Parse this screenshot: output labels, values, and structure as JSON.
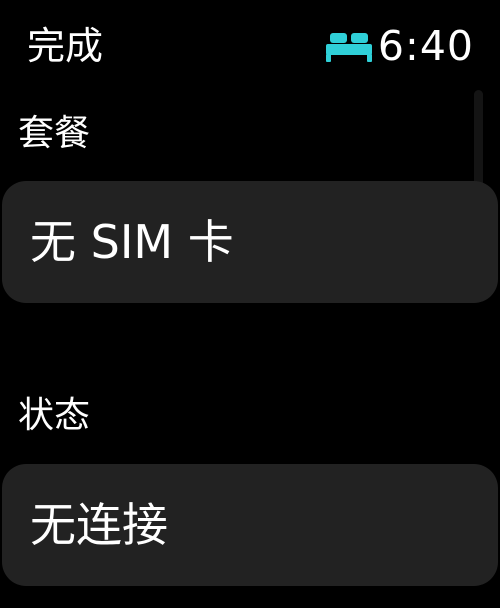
{
  "status_bar": {
    "done_label": "完成",
    "time": "6:40",
    "sleep_icon": "bed-icon",
    "sleep_icon_color": "#2fd0d8"
  },
  "sections": [
    {
      "label": "套餐",
      "value": "无 SIM 卡"
    },
    {
      "label": "状态",
      "value": "无连接"
    }
  ]
}
